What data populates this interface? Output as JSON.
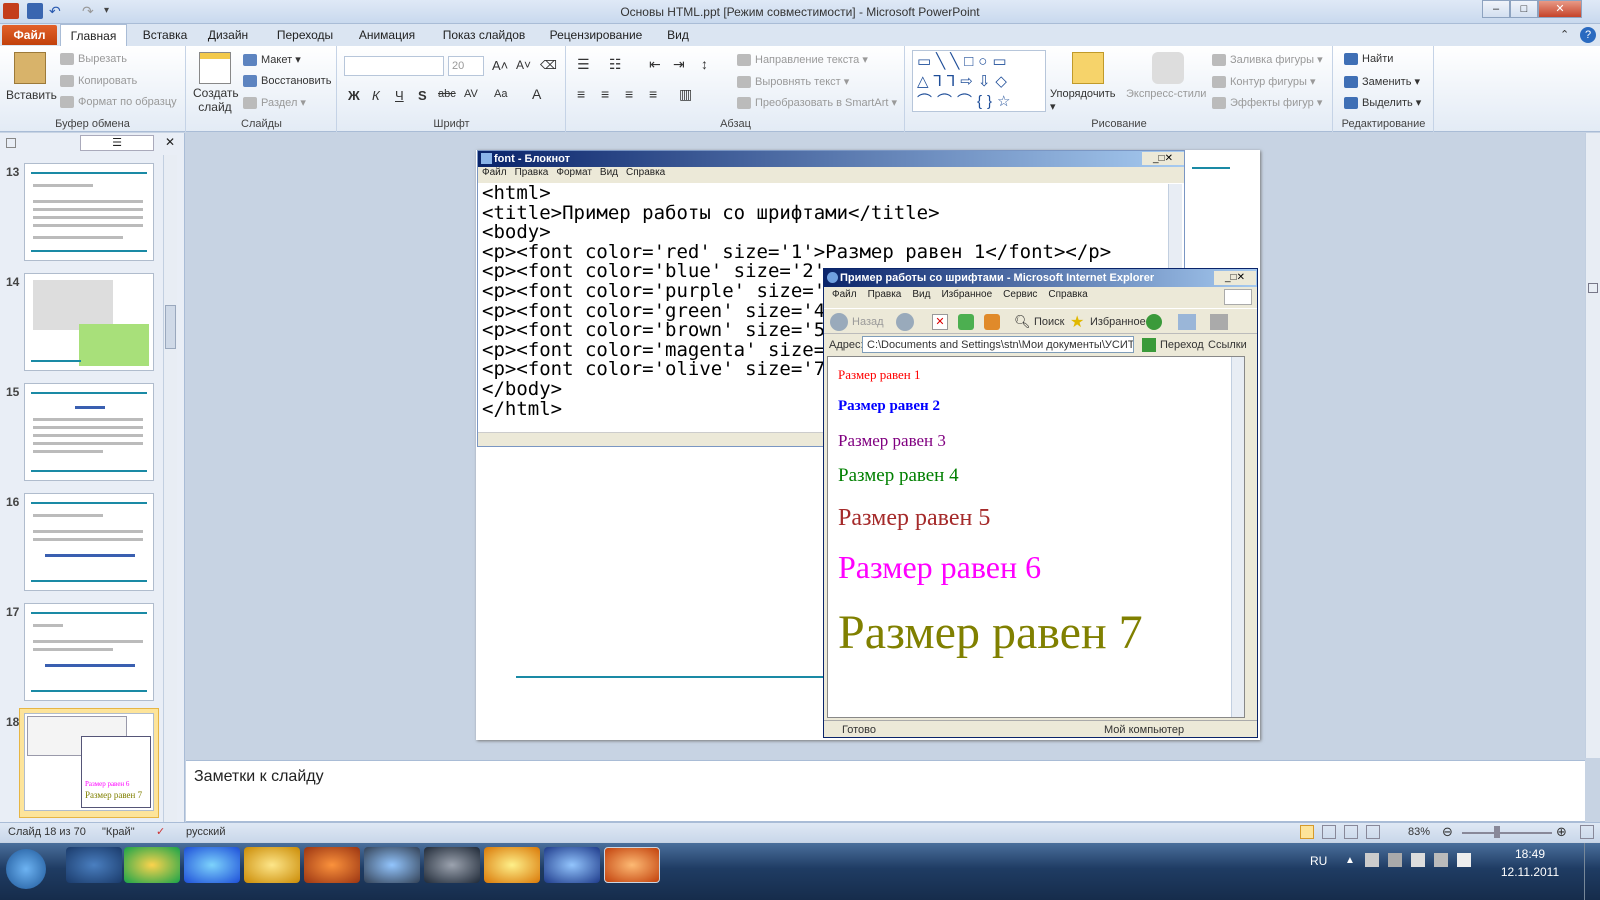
{
  "window": {
    "title": "Основы HTML.ppt [Режим совместимости]  -  Microsoft PowerPoint",
    "controls": {
      "minimize": "–",
      "maximize": "□",
      "close": "✕"
    }
  },
  "ribbon": {
    "file_tab": "Файл",
    "tabs": [
      "Главная",
      "Вставка",
      "Дизайн",
      "Переходы",
      "Анимация",
      "Показ слайдов",
      "Рецензирование",
      "Вид"
    ],
    "groups": {
      "clipboard": {
        "label": "Буфер обмена",
        "paste": "Вставить",
        "cut": "Вырезать",
        "copy": "Копировать",
        "format_painter": "Формат по образцу"
      },
      "slides": {
        "label": "Слайды",
        "new_slide": "Создать слайд",
        "layout": "Макет",
        "reset": "Восстановить",
        "section": "Раздел"
      },
      "font": {
        "label": "Шрифт",
        "font_size": "20",
        "bold": "Ж",
        "italic": "К",
        "underline": "Ч",
        "shadow": "S",
        "strike": "abc",
        "spacing": "AV",
        "case": "Aa",
        "color": "A"
      },
      "paragraph": {
        "label": "Абзац",
        "text_direction": "Направление текста",
        "align_text": "Выровнять текст",
        "smartart": "Преобразовать в SmartArt"
      },
      "drawing": {
        "label": "Рисование",
        "arrange": "Упорядочить",
        "quick_styles": "Экспресс-стили",
        "fill": "Заливка фигуры",
        "outline": "Контур фигуры",
        "effects": "Эффекты фигур"
      },
      "editing": {
        "label": "Редактирование",
        "find": "Найти",
        "replace": "Заменить",
        "select": "Выделить"
      }
    }
  },
  "thumbnails": [
    {
      "num": "13"
    },
    {
      "num": "14"
    },
    {
      "num": "15"
    },
    {
      "num": "16"
    },
    {
      "num": "17"
    },
    {
      "num": "18"
    }
  ],
  "thumb18_text": {
    "size6": "Размер равен 6",
    "size7": "Размер равен 7"
  },
  "notepad": {
    "title": "font - Блокнот",
    "menu": [
      "Файл",
      "Правка",
      "Формат",
      "Вид",
      "Справка"
    ],
    "code": "<html>\n<title>Пример работы со шрифтами</title>\n<body>\n<p><font color='red' size='1'>Размер равен 1</font></p>\n<p><font color='blue' size='2'\n<p><font color='purple' size='\n<p><font color='green' size='4\n<p><font color='brown' size='5\n<p><font color='magenta' size=\n<p><font color='olive' size='7\n</body>\n</html>"
  },
  "browser": {
    "title": "Пример работы со шрифтами - Microsoft Internet Explorer",
    "menu": [
      "Файл",
      "Правка",
      "Вид",
      "Избранное",
      "Сервис",
      "Справка"
    ],
    "toolbar": {
      "back": "Назад",
      "search": "Поиск",
      "favorites": "Избранное"
    },
    "address_label": "Адрес:",
    "address_value": "C:\\Documents and Settings\\stn\\Мои документы\\УСИТО\\ФПК",
    "go": "Переход",
    "links": "Ссылки",
    "status_left": "Готово",
    "status_right": "Мой компьютер",
    "lines": [
      {
        "text": "Размер равен 1",
        "color": "#ff0000"
      },
      {
        "text": "Размер равен 2",
        "color": "#0000ff"
      },
      {
        "text": "Размер равен 3",
        "color": "#800080"
      },
      {
        "text": "Размер равен 4",
        "color": "#008000"
      },
      {
        "text": "Размер равен 5",
        "color": "#a52a2a"
      },
      {
        "text": "Размер равен 6",
        "color": "#ff00ff"
      },
      {
        "text": "Размер равен 7",
        "color": "#808000"
      }
    ]
  },
  "notes": {
    "placeholder": "Заметки к слайду"
  },
  "statusbar": {
    "slide": "Слайд 18 из 70",
    "theme": "\"Край\"",
    "language": "русский",
    "zoom": "83%"
  },
  "taskbar": {
    "lang": "RU",
    "time": "18:49",
    "date": "12.11.2011"
  }
}
